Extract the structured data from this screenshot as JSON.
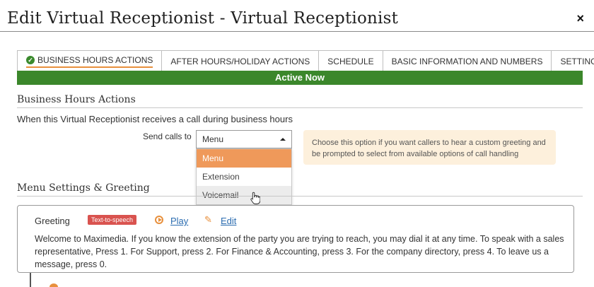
{
  "modal": {
    "title": "Edit Virtual Receptionist - Virtual Receptionist",
    "close_label": "×"
  },
  "tabs": [
    {
      "label": "BUSINESS HOURS ACTIONS",
      "active": true,
      "icon": "check-circle-icon"
    },
    {
      "label": "AFTER HOURS/HOLIDAY ACTIONS",
      "active": false
    },
    {
      "label": "SCHEDULE",
      "active": false
    },
    {
      "label": "BASIC INFORMATION AND NUMBERS",
      "active": false
    },
    {
      "label": "SETTINGS",
      "active": false
    }
  ],
  "status": {
    "label": "Active Now",
    "color": "#3b872b"
  },
  "business_hours": {
    "heading": "Business Hours Actions",
    "intro": "When this Virtual Receptionist receives a call during business hours",
    "send_label": "Send calls to",
    "selected_value": "Menu",
    "options": [
      "Menu",
      "Extension",
      "Voicemail"
    ],
    "info": "Choose this option if you want callers to hear a custom greeting and be prompted to select from available options of call handling"
  },
  "menu_settings": {
    "heading": "Menu Settings & Greeting",
    "greeting_label": "Greeting",
    "badge": "Text-to-speech",
    "play_label": "Play",
    "edit_label": "Edit",
    "greeting_text": "Welcome to Maximedia. If you know the extension of the party you are trying to reach, you may dial it at any time. To speak with a sales representative, Press 1. For Support, press 2. For Finance & Accounting, press 3. For the company directory, press 4. To leave us a message, press 0."
  },
  "colors": {
    "accent": "#e8903d",
    "selected_option": "#ef995a",
    "info_bg": "#fdf0dc",
    "badge": "#d9534f",
    "link": "#2b6cb0"
  }
}
